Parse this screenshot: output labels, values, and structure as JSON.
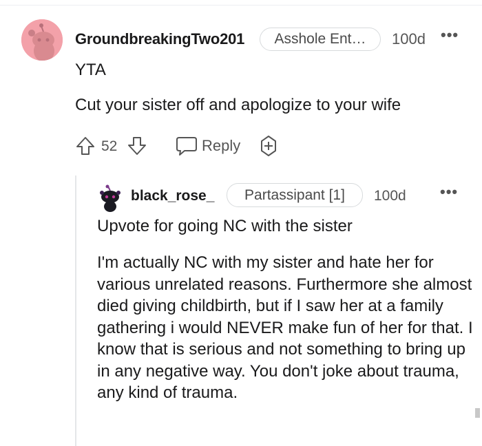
{
  "parent_comment": {
    "author": "GroundbreakingTwo201",
    "flair": "Asshole Ent…",
    "time": "100d",
    "more_icon": "ellipsis-icon",
    "body_lines": [
      "YTA",
      "Cut your sister off and apologize to your wife"
    ],
    "score": "52",
    "reply_label": "Reply",
    "avatar_color": "#f3a1a9"
  },
  "reply_comment": {
    "author": "black_rose_",
    "flair": "Partassipant [1]",
    "time": "100d",
    "more_icon": "ellipsis-icon",
    "body_lines": [
      "Upvote for going NC with the sister",
      "I'm actually NC with my sister and hate her for various unrelated reasons. Furthermore she almost died giving childbirth, but if I saw her at a family gathering i would NEVER make fun of her for that. I know that is serious and not something to bring up in any negative way. You don't joke about trauma, any kind of trauma."
    ]
  }
}
